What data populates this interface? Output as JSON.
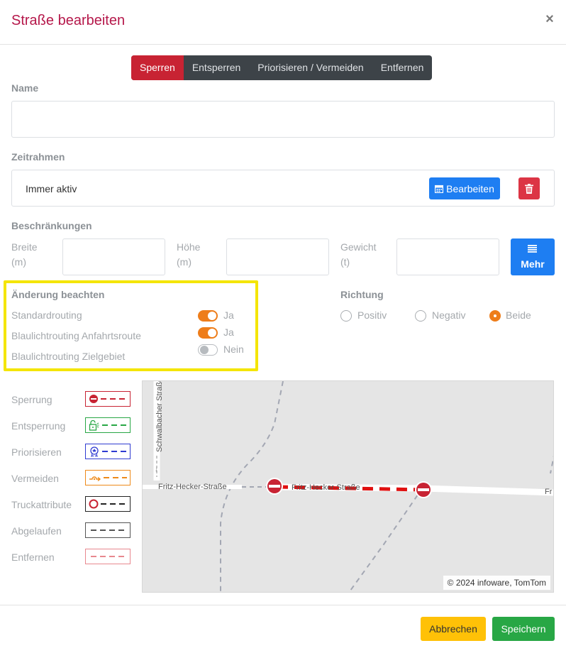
{
  "header": {
    "title": "Straße bearbeiten",
    "close_label": "×"
  },
  "tabs": [
    {
      "label": "Sperren",
      "active": true
    },
    {
      "label": "Entsperren",
      "active": false
    },
    {
      "label": "Priorisieren / Vermeiden",
      "active": false
    },
    {
      "label": "Entfernen",
      "active": false
    }
  ],
  "name_section": {
    "label": "Name",
    "value": ""
  },
  "zeitrahmen": {
    "label": "Zeitrahmen",
    "value": "Immer aktiv",
    "edit_label": "Bearbeiten"
  },
  "beschraenkungen": {
    "label": "Beschränkungen",
    "breite": {
      "label_line1": "Breite",
      "label_line2": "(m)",
      "value": ""
    },
    "hoehe": {
      "label_line1": "Höhe",
      "label_line2": "(m)",
      "value": ""
    },
    "gewicht": {
      "label_line1": "Gewicht",
      "label_line2": "(t)",
      "value": ""
    },
    "mehr_label": "Mehr"
  },
  "aenderung": {
    "label": "Änderung beachten",
    "items": [
      {
        "label": "Standardrouting",
        "state_label": "Ja",
        "on": true
      },
      {
        "label": "Blaulichtrouting Anfahrtsroute",
        "state_label": "Ja",
        "on": true
      },
      {
        "label": "Blaulichtrouting Zielgebiet",
        "state_label": "Nein",
        "on": false
      }
    ]
  },
  "richtung": {
    "label": "Richtung",
    "options": [
      {
        "label": "Positiv",
        "checked": false
      },
      {
        "label": "Negativ",
        "checked": false
      },
      {
        "label": "Beide",
        "checked": true
      }
    ]
  },
  "legend": [
    {
      "label": "Sperrung",
      "color": "#c82333",
      "icon": "no-entry-icon"
    },
    {
      "label": "Entsperrung",
      "color": "#28a745",
      "icon": "unlock-icon"
    },
    {
      "label": "Priorisieren",
      "color": "#2f3bd1",
      "icon": "badge-icon"
    },
    {
      "label": "Vermeiden",
      "color": "#ee8a1a",
      "icon": "detour-icon"
    },
    {
      "label": "Truckattribute",
      "color": "#222222",
      "icon": "circle-icon"
    },
    {
      "label": "Abgelaufen",
      "color": "#555555",
      "icon": ""
    },
    {
      "label": "Entfernen",
      "color": "#e8888f",
      "icon": ""
    }
  ],
  "map": {
    "street_vertical": "Schwalbacher Straße",
    "street_left": "Fritz-Hecker-Straße",
    "street_middle": "Fritz-Hecker-Straße",
    "street_right_partial": "Fr",
    "attribution": "© 2024 infoware, TomTom"
  },
  "footer": {
    "cancel_label": "Abbrechen",
    "save_label": "Speichern"
  }
}
